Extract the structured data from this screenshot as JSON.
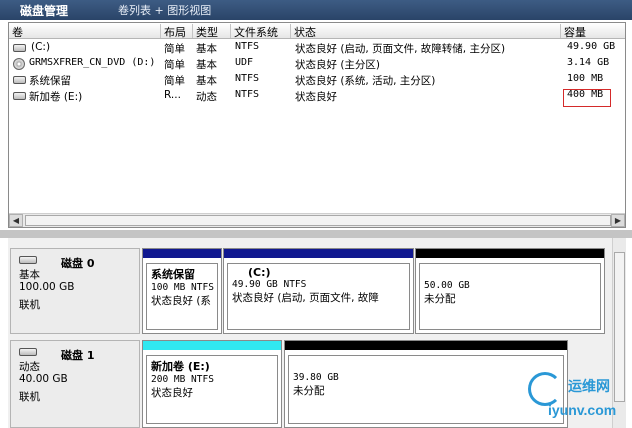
{
  "titlebar": {
    "app": "磁盘管理",
    "views": "卷列表 + 图形视图"
  },
  "columns": [
    "卷",
    "布局",
    "类型",
    "文件系统",
    "状态",
    "容量"
  ],
  "volumes": [
    {
      "name": "(C:)",
      "layout": "简单",
      "type": "基本",
      "fs": "NTFS",
      "status": "状态良好 (启动, 页面文件, 故障转储, 主分区)",
      "capacity": "49.90 GB",
      "icon": "drive-icon"
    },
    {
      "name": "GRMSXFRER_CN_DVD (D:)",
      "layout": "简单",
      "type": "基本",
      "fs": "UDF",
      "status": "状态良好 (主分区)",
      "capacity": "3.14 GB",
      "icon": "cd-drive-icon"
    },
    {
      "name": "系统保留",
      "layout": "简单",
      "type": "基本",
      "fs": "NTFS",
      "status": "状态良好 (系统, 活动, 主分区)",
      "capacity": "100 MB",
      "icon": "drive-icon"
    },
    {
      "name": "新加卷 (E:)",
      "layout": "R...",
      "type": "动态",
      "fs": "NTFS",
      "status": "状态良好",
      "capacity": "400 MB",
      "icon": "drive-icon"
    }
  ],
  "disks": [
    {
      "name": "磁盘 0",
      "kind": "基本",
      "size": "100.00 GB",
      "state": "联机",
      "partitions": [
        {
          "title": "系统保留",
          "size": "100 MB NTFS",
          "status": "状态良好 (系",
          "color": "#101890"
        },
        {
          "title": "(C:)",
          "size": "49.90 GB NTFS",
          "status": "状态良好 (启动, 页面文件, 故障",
          "color": "#101890"
        },
        {
          "title": "",
          "size": "50.00 GB",
          "status": "未分配",
          "color": "#000000"
        }
      ]
    },
    {
      "name": "磁盘 1",
      "kind": "动态",
      "size": "40.00 GB",
      "state": "联机",
      "partitions": [
        {
          "title": "新加卷 (E:)",
          "size": "200 MB NTFS",
          "status": "状态良好",
          "color": "#30e8f0"
        },
        {
          "title": "",
          "size": "39.80 GB",
          "status": "未分配",
          "color": "#000000"
        }
      ]
    }
  ],
  "watermark": {
    "cn": "运维网",
    "en": "iyunv.com"
  }
}
